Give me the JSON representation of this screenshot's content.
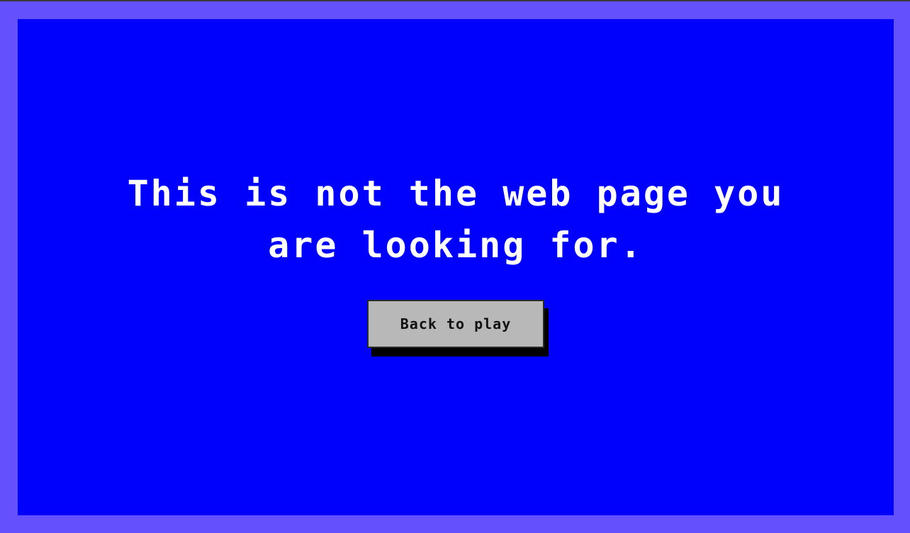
{
  "message": {
    "line1": "This is not the web page you",
    "line2": "are looking for."
  },
  "button": {
    "label": "Back to play"
  },
  "colors": {
    "frame": "#6450fc",
    "screen": "#0000fd",
    "text": "#ffffff",
    "button_bg": "#b8b8b8",
    "button_shadow": "#000000"
  }
}
